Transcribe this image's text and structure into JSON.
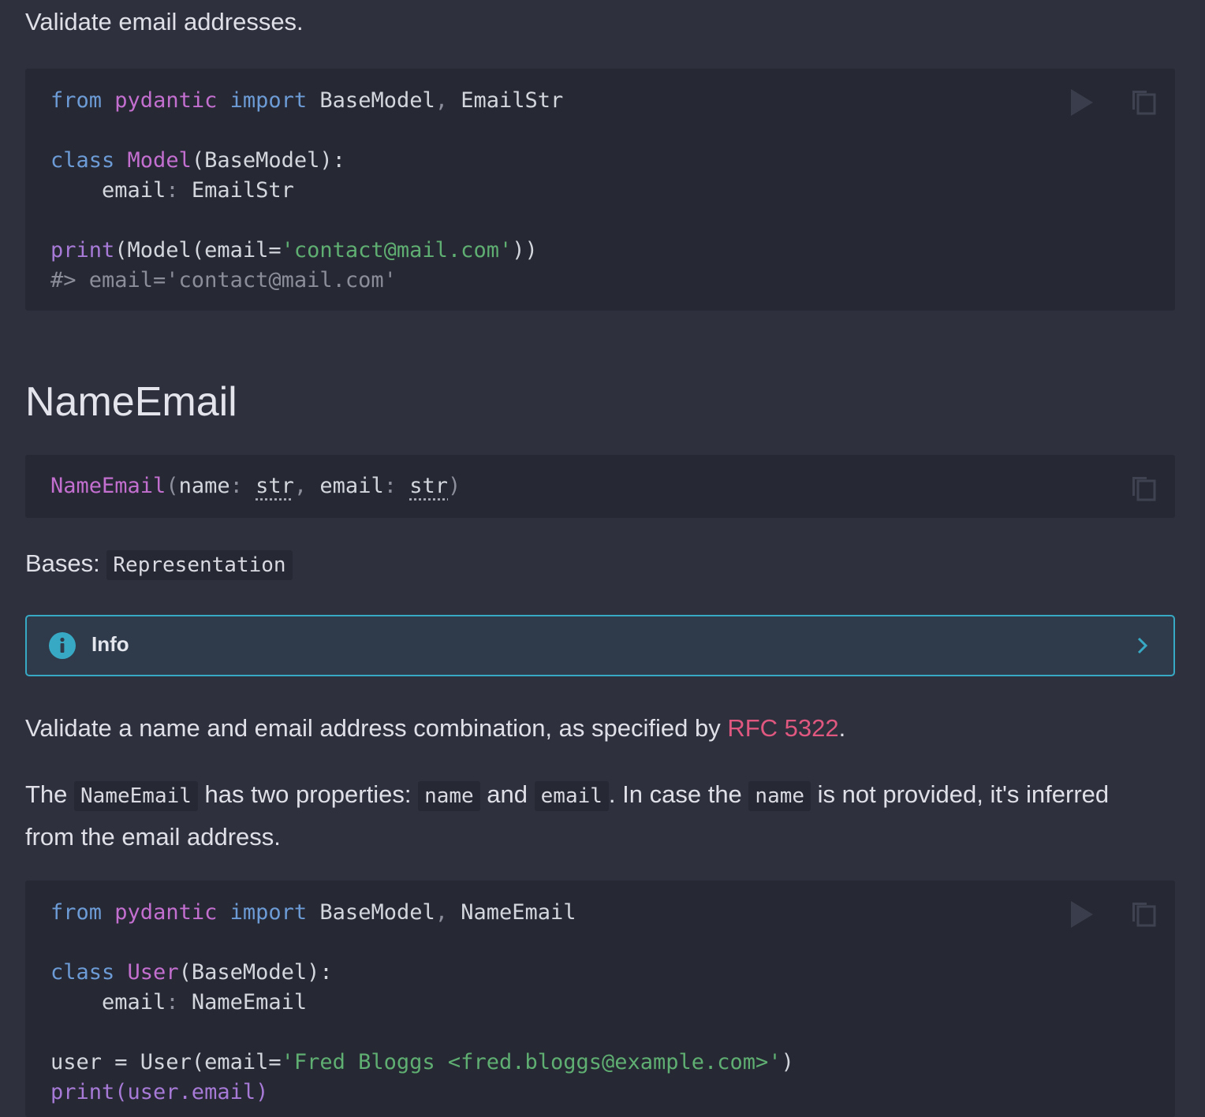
{
  "intro_text": "Validate email addresses.",
  "code_example_1": {
    "lines": {
      "l1": {
        "a": "from",
        "b": "pydantic",
        "c": "import",
        "d": "BaseModel",
        "e": ",",
        "f": "EmailStr"
      },
      "l3": {
        "a": "class",
        "b": "Model",
        "c": "(BaseModel):"
      },
      "l4": {
        "a": "email",
        "b": ":",
        "c": "EmailStr"
      },
      "l6": {
        "a": "print",
        "b": "(Model(email=",
        "c": "'contact@mail.com'",
        "d": "))"
      },
      "l7": "#> email='contact@mail.com'"
    }
  },
  "section": {
    "title": "NameEmail"
  },
  "signature": {
    "name": "NameEmail",
    "open": "(",
    "p1": "name",
    "colon1": ": ",
    "t1": "str",
    "sep": ", ",
    "p2": "email",
    "colon2": ": ",
    "t2": "str",
    "close": ")"
  },
  "bases": {
    "label": "Bases:",
    "value": "Representation"
  },
  "admonition": {
    "title": "Info",
    "icon": "info-icon",
    "expand_icon": "chevron-right-icon",
    "color": "#38a9c4"
  },
  "description": {
    "p1_text": "Validate a name and email address combination, as specified by ",
    "p1_link": "RFC 5322",
    "p1_end": ".",
    "p2_a": "The ",
    "p2_code1": "NameEmail",
    "p2_b": " has two properties: ",
    "p2_code2": "name",
    "p2_c": " and ",
    "p2_code3": "email",
    "p2_d": ". In case the ",
    "p2_code4": "name",
    "p2_e": " is not provided, it's inferred from the email address."
  },
  "code_example_2": {
    "lines": {
      "l1": {
        "a": "from",
        "b": "pydantic",
        "c": "import",
        "d": "BaseModel",
        "e": ",",
        "f": "NameEmail"
      },
      "l3": {
        "a": "class",
        "b": "User",
        "c": "(BaseModel):"
      },
      "l4": {
        "a": "email",
        "b": ":",
        "c": "NameEmail"
      },
      "l6": {
        "a": "user",
        "b": " = User(email=",
        "c": "'Fred Bloggs <fred.bloggs@example.com>'",
        "d": ")"
      },
      "l7": "print(user.email)"
    }
  },
  "colors": {
    "background": "#2e303e",
    "code_background": "#262833",
    "keyword": "#6c9bd6",
    "module": "#c36fd0",
    "string": "#5fae72",
    "link": "#e0577f"
  }
}
